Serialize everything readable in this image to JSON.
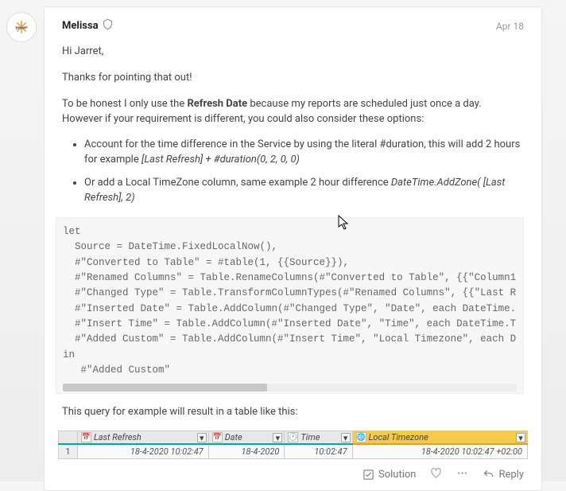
{
  "post": {
    "author": "Melissa",
    "date": "Apr 18",
    "greeting": "Hi Jarret,",
    "thanks": "Thanks for pointing that out!",
    "para1_pre": "To be honest I only use the ",
    "para1_strong": "Refresh Date",
    "para1_post": " because my reports are scheduled just once a day. However if your requirement is different, you could also consider these options:",
    "bullet1_text": "Account for the time difference in the Service by using the literal #duration, this will add 2 hours for example ",
    "bullet1_em": "[Last Refresh] + #duration(0, 2, 0, 0)",
    "bullet2_text": "Or add a Local TimeZone column, same example 2 hour difference ",
    "bullet2_em": "DateTime.AddZone( [Last Refresh], 2)",
    "code": "let\n  Source = DateTime.FixedLocalNow(),\n  #\"Converted to Table\" = #table(1, {{Source}}),\n  #\"Renamed Columns\" = Table.RenameColumns(#\"Converted to Table\", {{\"Column1\n  #\"Changed Type\" = Table.TransformColumnTypes(#\"Renamed Columns\", {{\"Last R\n  #\"Inserted Date\" = Table.AddColumn(#\"Changed Type\", \"Date\", each DateTime.\n  #\"Insert Time\" = Table.AddColumn(#\"Inserted Date\", \"Time\", each DateTime.T\n  #\"Added Custom\" = Table.AddColumn(#\"Insert Time\", \"Local Timezone\", each D\nin\n   #\"Added Custom\"",
    "table_intro": "This query for example will result in a table like this:",
    "table": {
      "headers": [
        "Last Refresh",
        "Date",
        "Time",
        "Local Timezone"
      ],
      "row_index": "1",
      "row": [
        "18-4-2020 10:02:47",
        "18-4-2020",
        "10:02:47",
        "18-4-2020 10:02:47 +02:00"
      ]
    },
    "footer": {
      "solution": "Solution",
      "reply": "Reply"
    }
  }
}
